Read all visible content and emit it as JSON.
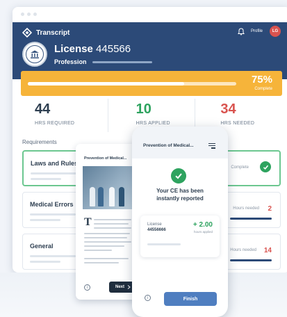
{
  "app": {
    "title": "Transcript",
    "profile_label": "Profile",
    "avatar_initials": "LG"
  },
  "license": {
    "label": "License",
    "number": "445566",
    "profession": "Profession"
  },
  "progress": {
    "percent_text": "75%",
    "label": "Complete",
    "fraction": 0.75
  },
  "stats": [
    {
      "value": "44",
      "label": "HRS REQUIRED",
      "color": "#2d3e50"
    },
    {
      "value": "10",
      "label": "HRS APPLIED",
      "color": "#2ea35f"
    },
    {
      "value": "34",
      "label": "HRS NEEDED",
      "color": "#d9534f"
    }
  ],
  "requirements": {
    "title": "Requirements",
    "items": [
      {
        "name": "Laws and Rules",
        "status": "Complete"
      },
      {
        "name": "Medical Errors",
        "status": "Hours needed",
        "hours": "2"
      },
      {
        "name": "General",
        "status": "Hours needed",
        "hours": "14"
      }
    ]
  },
  "article": {
    "title": "Prevention of Medical...",
    "drop_cap": "T",
    "next_label": "Next"
  },
  "phone": {
    "title": "Prevention of Medical...",
    "message_line1": "Your CE has been",
    "message_line2": "instantly reported",
    "license_label": "License",
    "license_number": "44556666",
    "hours_value": "+ 2.00",
    "hours_label": "hours applied",
    "finish_label": "Finish"
  },
  "colors": {
    "header": "#2c4a78",
    "progress": "#f6b43a",
    "success": "#2ea35f",
    "alert": "#d9534f"
  }
}
